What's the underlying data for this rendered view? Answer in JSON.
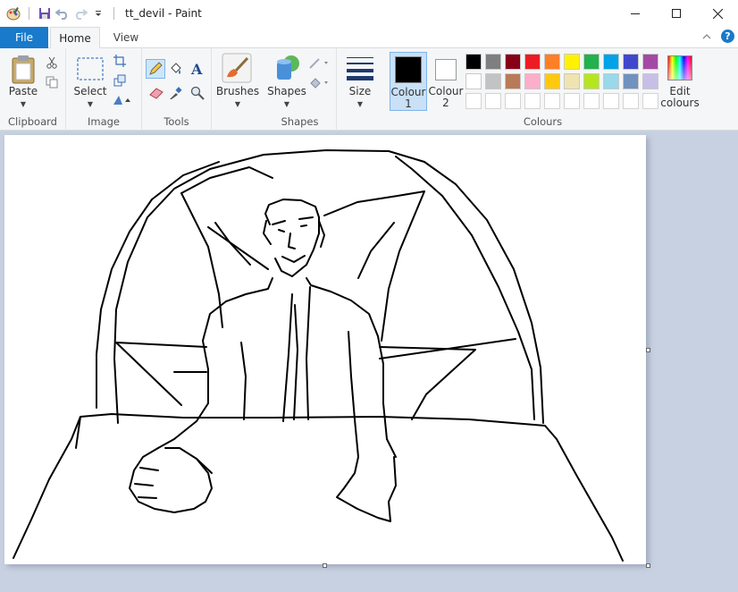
{
  "window": {
    "title": "tt_devil - Paint"
  },
  "quick_access": {
    "icons": [
      "paint-app-icon",
      "save-icon",
      "undo-icon",
      "redo-icon",
      "customize-dropdown-icon"
    ]
  },
  "tabs": [
    {
      "label": "File",
      "active": false
    },
    {
      "label": "Home",
      "active": true
    },
    {
      "label": "View",
      "active": false
    }
  ],
  "ribbon": {
    "clipboard": {
      "paste_label": "Paste",
      "group_label": "Clipboard"
    },
    "image": {
      "select_label": "Select",
      "group_label": "Image"
    },
    "tools": {
      "group_label": "Tools"
    },
    "brushes": {
      "label": "Brushes"
    },
    "shapes": {
      "label": "Shapes",
      "group_label": "Shapes"
    },
    "size": {
      "label": "Size"
    },
    "colours": {
      "colour1_label": "Colour 1",
      "colour1_line1": "Colour",
      "colour1_line2": "1",
      "colour2_line1": "Colour",
      "colour2_line2": "2",
      "colour1_value": "#000000",
      "colour2_value": "#ffffff",
      "edit_line1": "Edit",
      "edit_line2": "colours",
      "group_label": "Colours",
      "palette_row1": [
        "#000000",
        "#7f7f7f",
        "#880015",
        "#ed1c24",
        "#ff7f27",
        "#fff200",
        "#22b14c",
        "#00a2e8",
        "#3f48cc",
        "#a349a4"
      ],
      "palette_row2": [
        "#ffffff",
        "#c3c3c3",
        "#b97a57",
        "#ffaec9",
        "#ffc90e",
        "#efe4b0",
        "#b5e61d",
        "#99d9ea",
        "#7092be",
        "#c8bfe7"
      ],
      "palette_row3": [
        "",
        "",
        "",
        "",
        "",
        "",
        "",
        "",
        "",
        ""
      ]
    }
  },
  "canvas": {
    "background": "#ffffff",
    "drawing": "devil-sketch"
  }
}
